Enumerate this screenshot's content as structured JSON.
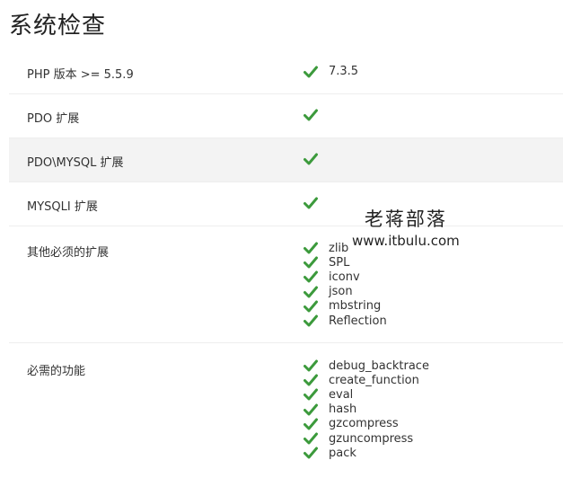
{
  "page": {
    "title": "系统检查"
  },
  "checks": [
    {
      "label": "PHP 版本 >= 5.5.9",
      "values": [
        "7.3.5"
      ]
    },
    {
      "label": "PDO 扩展",
      "values": [
        ""
      ]
    },
    {
      "label": "PDO\\MYSQL 扩展",
      "values": [
        ""
      ]
    },
    {
      "label": "MYSQLI 扩展",
      "values": [
        ""
      ]
    },
    {
      "label": "其他必须的扩展",
      "values": [
        "zlib",
        "SPL",
        "iconv",
        "json",
        "mbstring",
        "Reflection"
      ]
    },
    {
      "label": "必需的功能",
      "values": [
        "debug_backtrace",
        "create_function",
        "eval",
        "hash",
        "gzcompress",
        "gzuncompress",
        "pack"
      ]
    }
  ],
  "watermark": {
    "name": "老蒋部落",
    "url": "www.itbulu.com"
  },
  "icons": {
    "status": "checkmark-icon"
  },
  "colors": {
    "check": "#3c9a3c",
    "shaded_row": "#f3f3f3"
  }
}
